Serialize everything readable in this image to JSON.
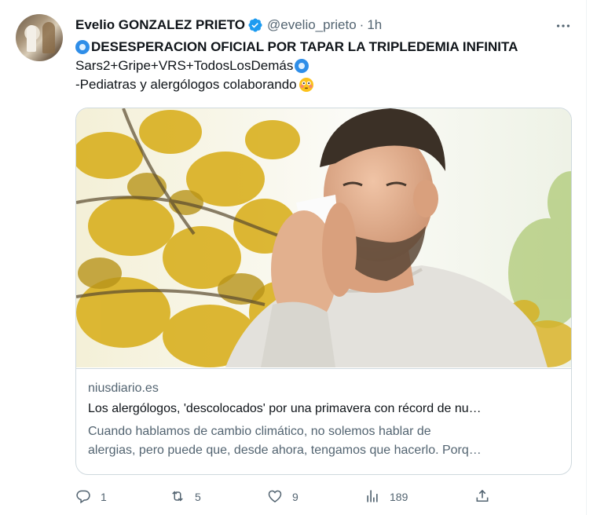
{
  "author": {
    "name": "Evelio GONZALEZ PRIETO",
    "handle": "@evelio_prieto",
    "separator": "·",
    "time": "1h"
  },
  "tweet": {
    "line1": "DESESPERACION OFICIAL POR TAPAR LA TRIPLEDEMIA INFINITA",
    "line2": "Sars2+Gripe+VRS+TodosLosDemás",
    "line3": "-Pediatras y alergólogos colaborando"
  },
  "card": {
    "domain": "niusdiario.es",
    "title": "Los alergólogos, 'descolocados' por una primavera con récord de nu…",
    "description_line1": "Cuando hablamos de cambio climático, no solemos hablar de",
    "description_line2": "alergias, pero puede que, desde ahora, tengamos que hacerlo. Porq…"
  },
  "actions": {
    "replies": "1",
    "retweets": "5",
    "likes": "9",
    "views": "189"
  },
  "icons": {
    "verified": "verified-badge-icon",
    "more": "more-dots-icon",
    "reply": "reply-icon",
    "retweet": "retweet-icon",
    "like": "heart-icon",
    "views": "views-chart-icon",
    "share": "share-icon",
    "emoji_radio": "radio-button-emoji",
    "emoji_flushed": "flushed-face-emoji"
  },
  "colors": {
    "text": "#0f1419",
    "secondary": "#536471",
    "verified": "#1d9bf0",
    "border": "#cfd9de"
  }
}
